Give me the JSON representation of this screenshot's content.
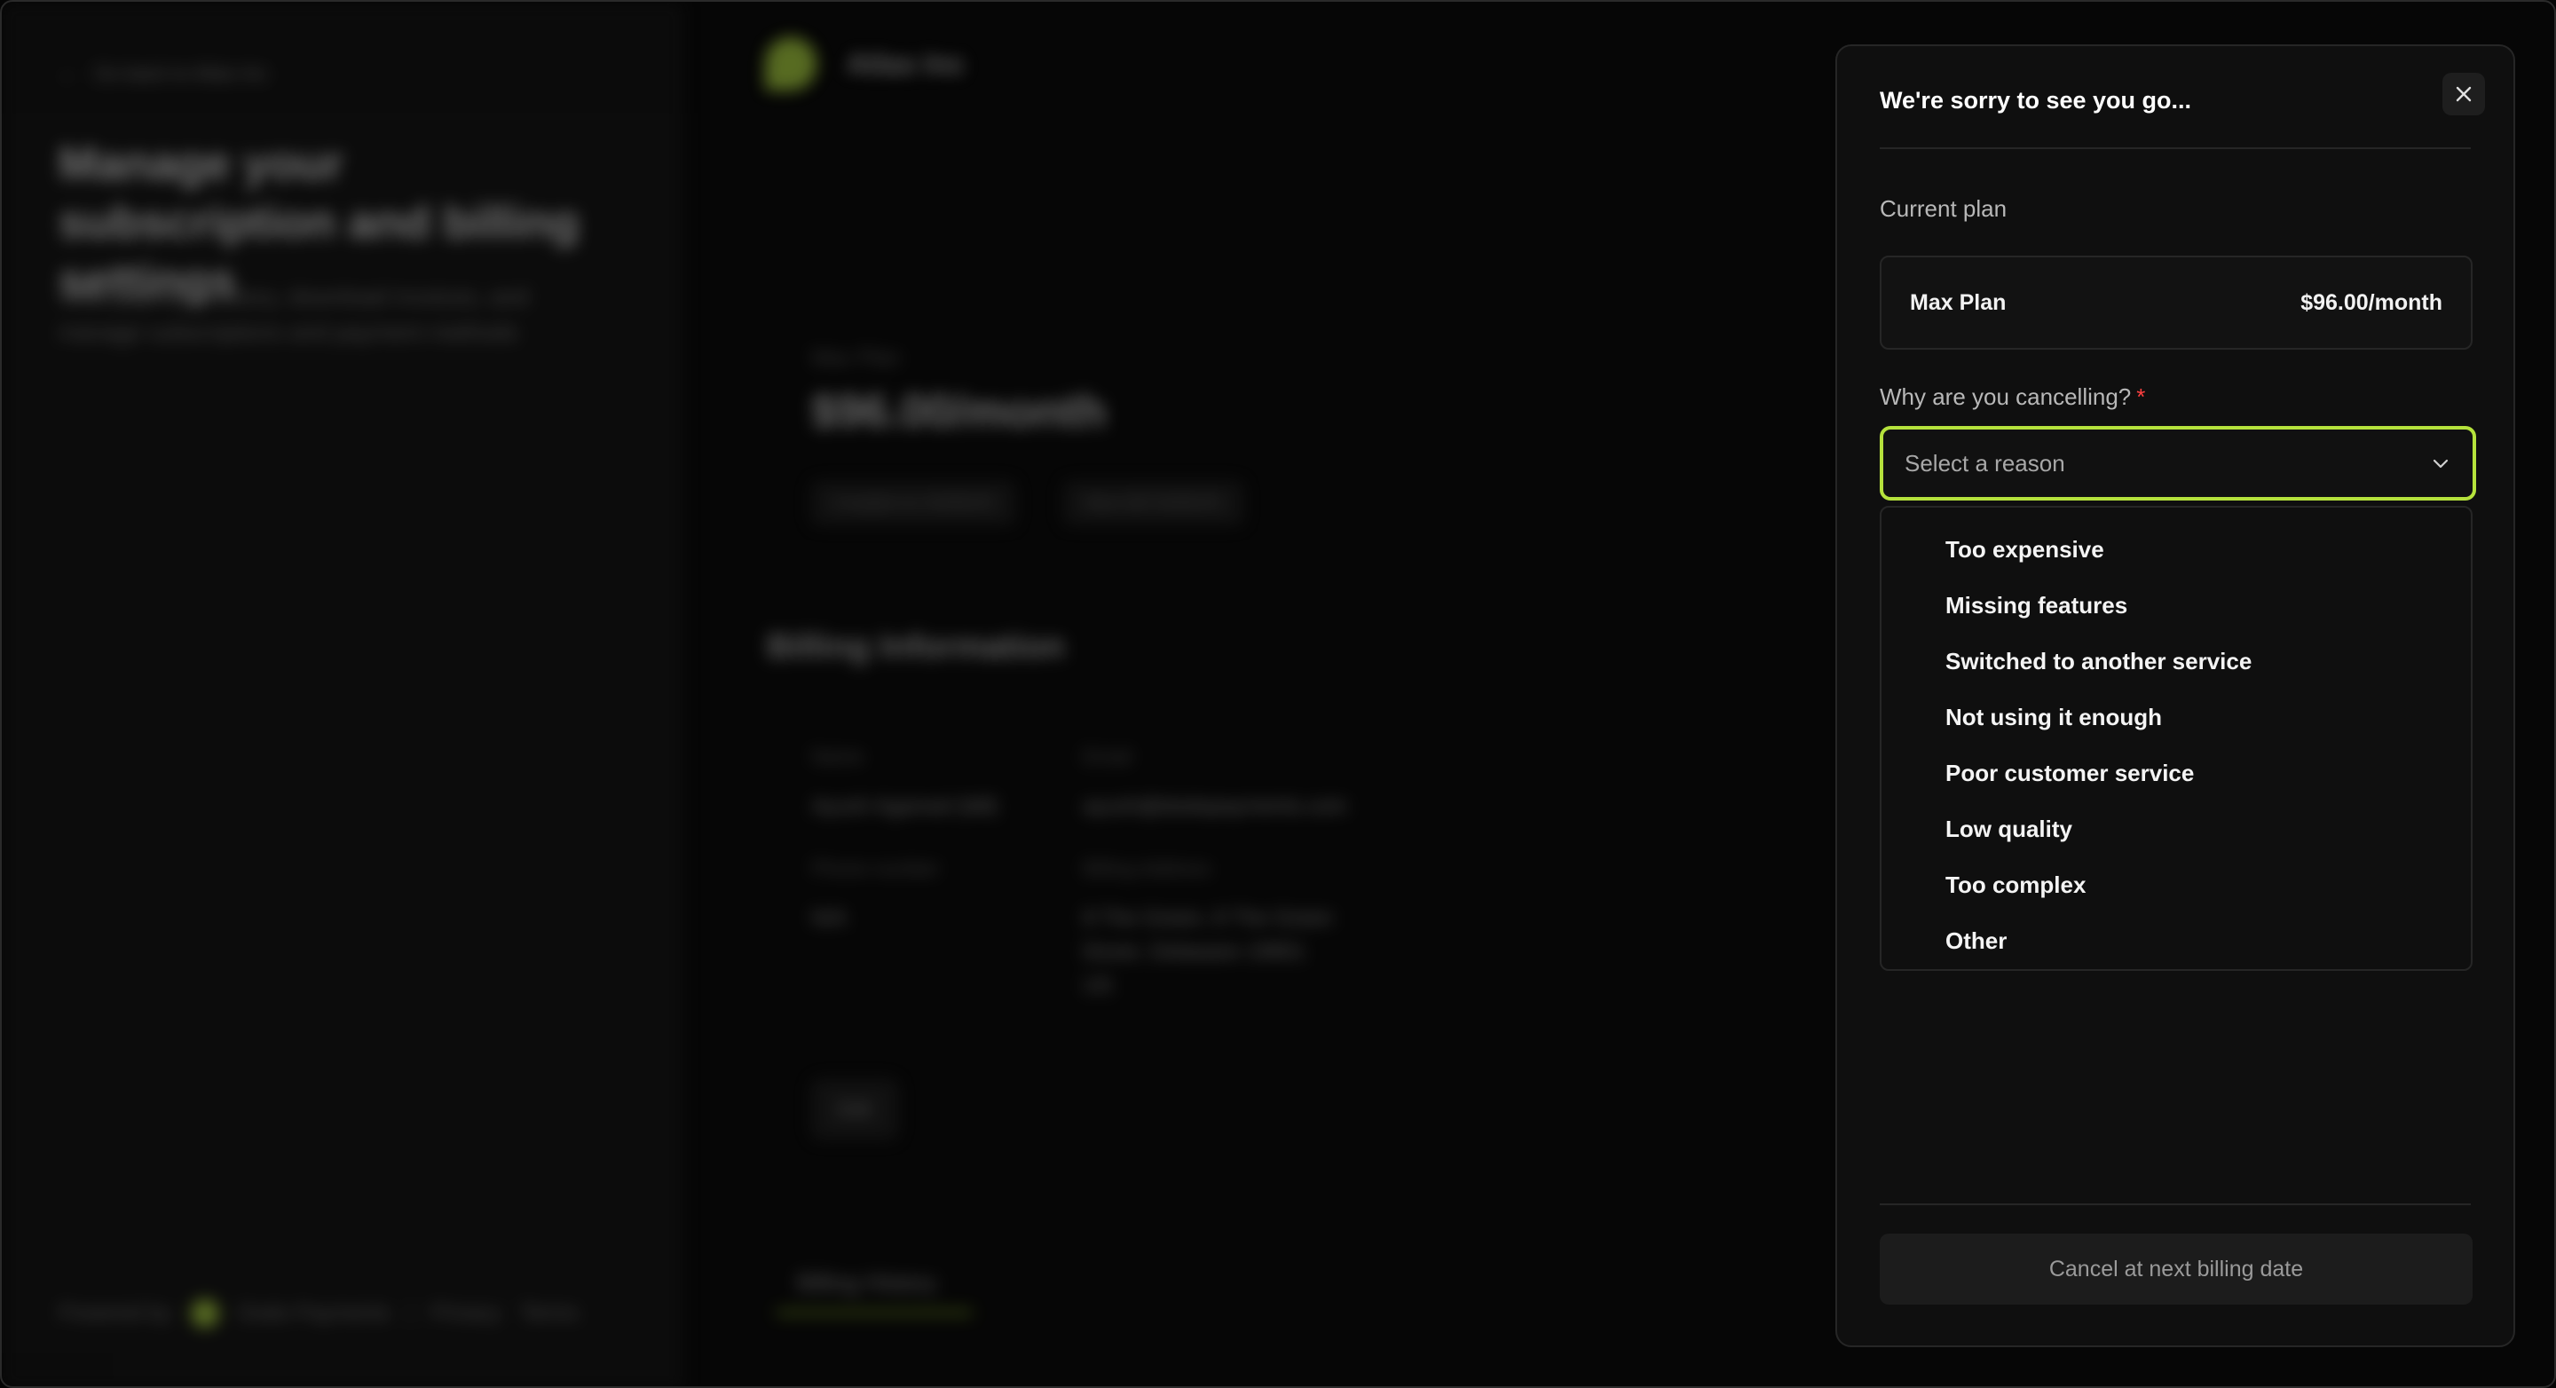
{
  "background": {
    "back_link": "Go back to Atlas Inc",
    "title": "Manage your subscription and billing settings",
    "description": "View payment history, download invoices, and manage subscriptions and payment methods",
    "footer": {
      "powered_by": "Powered by",
      "brand": "Dodo Payments",
      "privacy": "Privacy",
      "terms": "Terms"
    },
    "company_name": "Atlas Inc",
    "plan_label": "Max Plan",
    "plan_price": "$96.00/month",
    "chip_created": "Created on 03/05/25",
    "chip_next": "Next bill 03/05/25",
    "billing_title": "Billing Information",
    "fields": {
      "name_label": "Name",
      "name_value": "Ayush Agarwal (bill)",
      "email_label": "Email",
      "email_value": "ayush@dodopayments.com",
      "phone_label": "Phone number",
      "phone_value": "N/A",
      "address_label": "Billing Address",
      "address_line1": "8 The Green, 8 The Green",
      "address_line2": "Dover, Delaware 19901",
      "address_line3": "US"
    },
    "edit_label": "Edit",
    "tab_label": "Billing History"
  },
  "drawer": {
    "title": "We're sorry to see you go...",
    "current_plan_label": "Current plan",
    "plan_name": "Max Plan",
    "plan_price": "$96.00/month",
    "reason_label": "Why are you cancelling?",
    "required_marker": "*",
    "select_placeholder": "Select a reason",
    "options": [
      "Too expensive",
      "Missing features",
      "Switched to another service",
      "Not using it enough",
      "Poor customer service",
      "Low quality",
      "Too complex",
      "Other"
    ],
    "cancel_button": "Cancel at next billing date"
  },
  "colors": {
    "accent": "#b5e23c",
    "required": "#ff4040",
    "panel": "#0f0f0f"
  },
  "icons": {
    "close": "close-icon",
    "dropdown": "chevron-down-icon",
    "back": "arrow-left-icon"
  }
}
